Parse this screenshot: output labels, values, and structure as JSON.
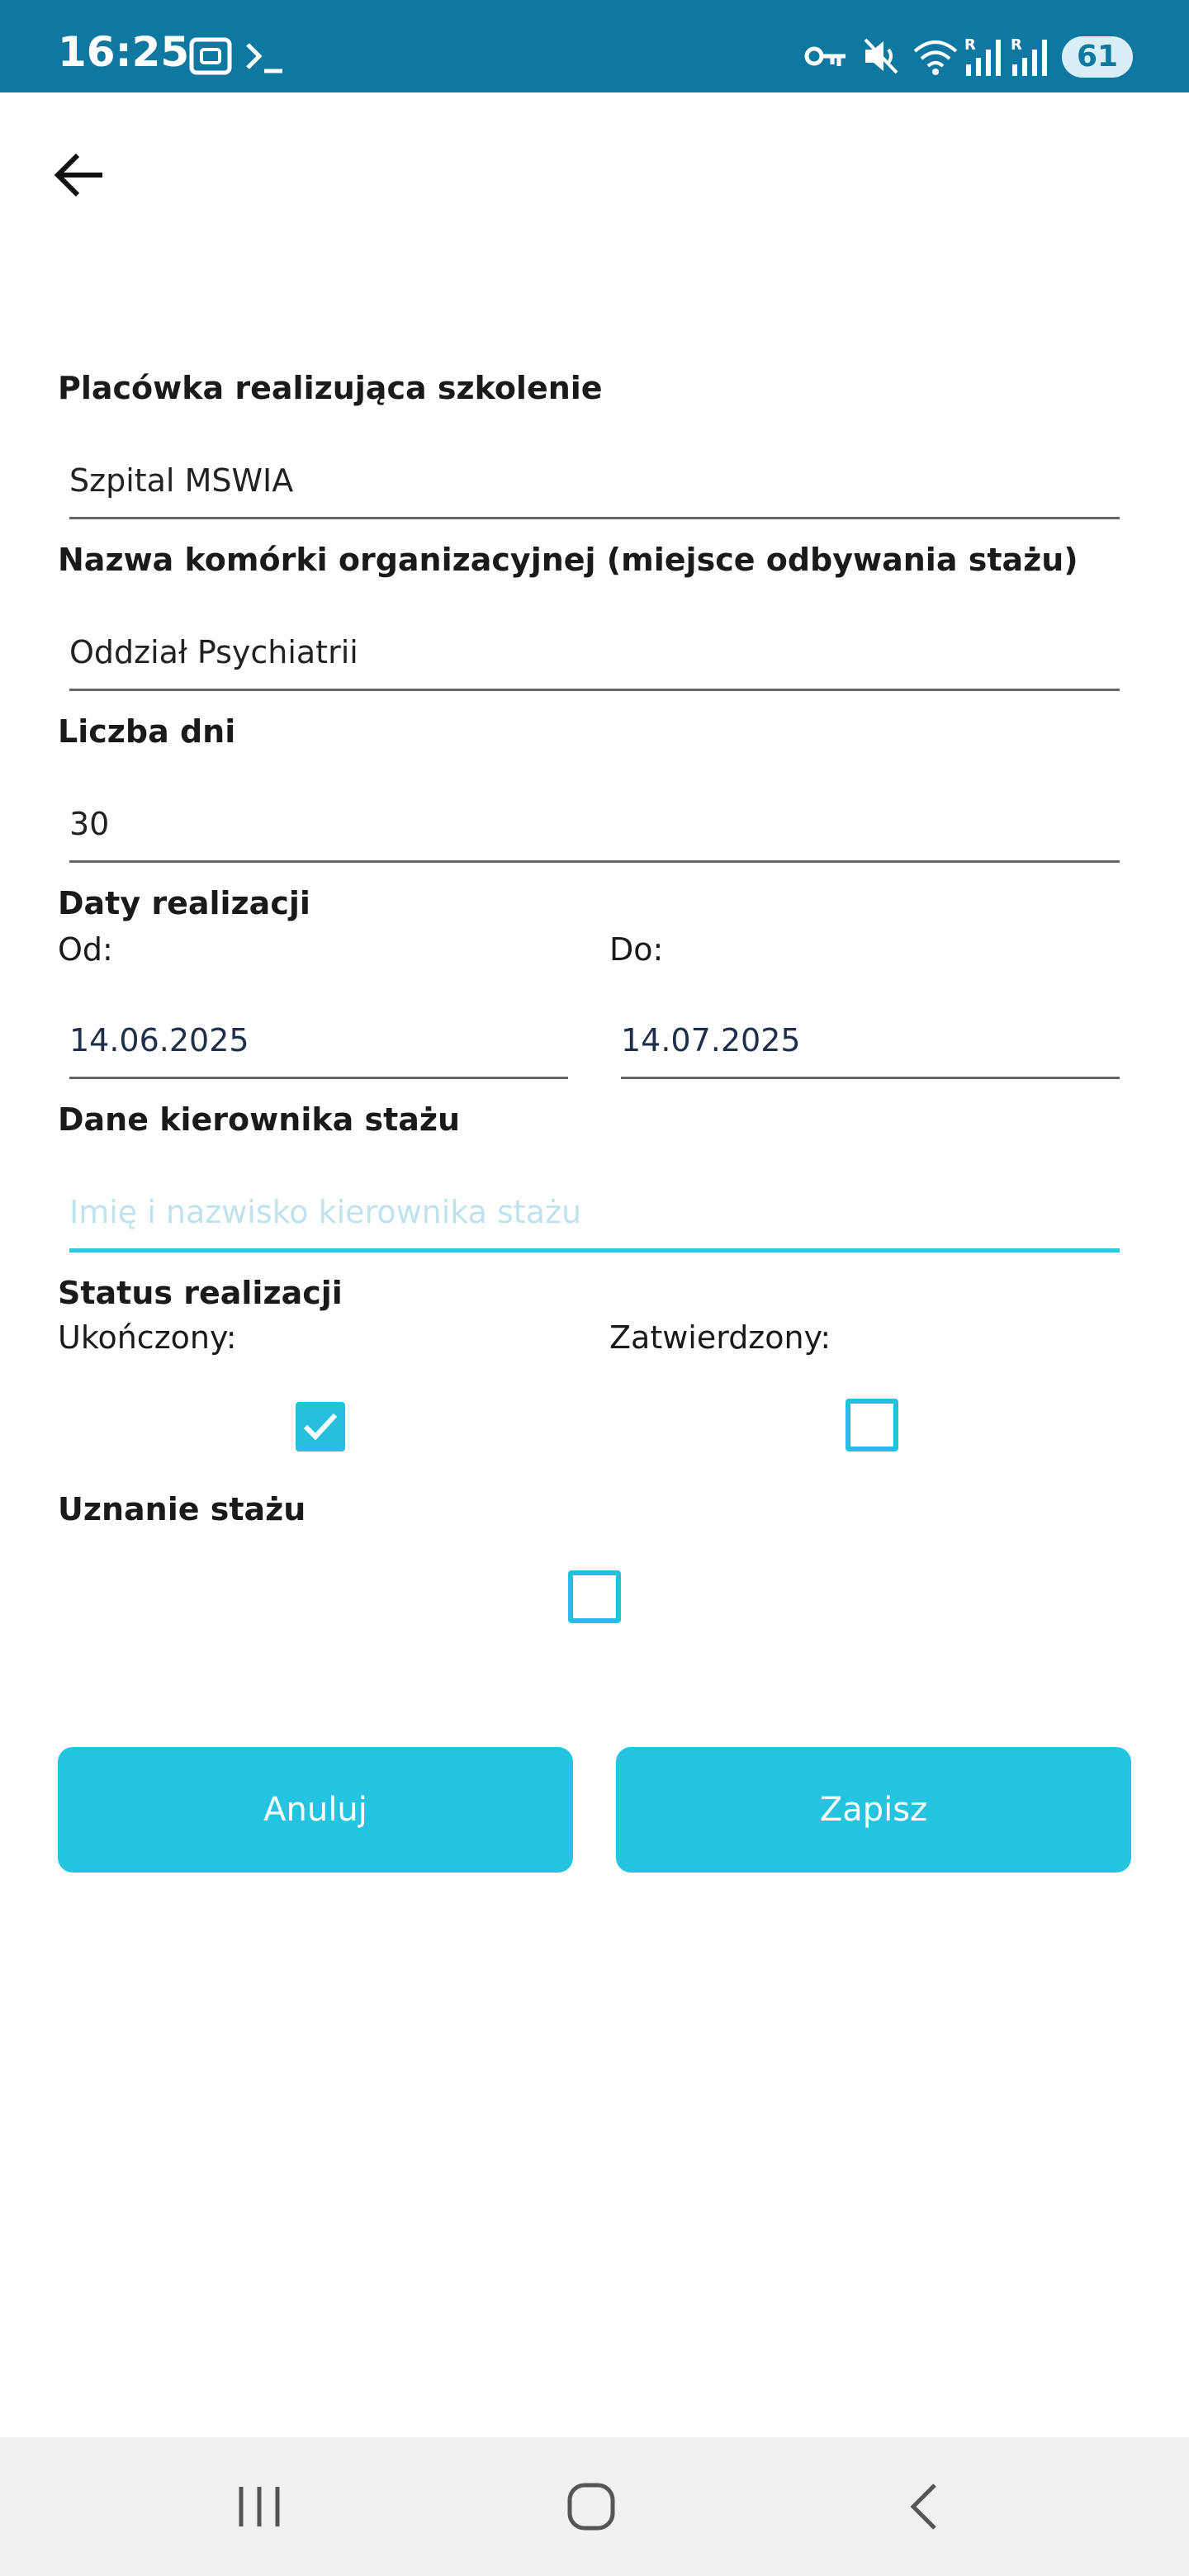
{
  "status_bar": {
    "time": "16:25",
    "battery": "61",
    "icons": [
      "screenshot-icon",
      "terminal-icon",
      "vpn-key-icon",
      "mute-icon",
      "wifi-icon",
      "signal-r-icon",
      "signal-r-icon",
      "battery-icon"
    ]
  },
  "header": {
    "back_icon": "arrow-left-icon"
  },
  "form": {
    "facility": {
      "label": "Placówka realizująca szkolenie",
      "value": "Szpital MSWIA"
    },
    "unit": {
      "label": "Nazwa komórki organizacyjnej (miejsce odbywania stażu)",
      "value": "Oddział Psychiatrii"
    },
    "days": {
      "label": "Liczba dni",
      "value": "30"
    },
    "dates": {
      "label": "Daty realizacji",
      "from_label": "Od:",
      "from_value": "14.06.2025",
      "to_label": "Do:",
      "to_value": "14.07.2025"
    },
    "supervisor": {
      "label": "Dane kierownika stażu",
      "placeholder": "Imię i nazwisko kierownika stażu",
      "value": ""
    },
    "status": {
      "label": "Status realizacji",
      "completed_label": "Ukończony:",
      "completed_checked": true,
      "approved_label": "Zatwierdzony:",
      "approved_checked": false
    },
    "recognition": {
      "label": "Uznanie stażu",
      "checked": false
    }
  },
  "actions": {
    "cancel_label": "Anuluj",
    "save_label": "Zapisz"
  },
  "colors": {
    "status_bar": "#0f78a0",
    "accent": "#24c3df",
    "nav_bar": "#f1f1f3"
  },
  "nav_bar": {
    "icons": [
      "recent-apps-icon",
      "home-icon",
      "back-nav-icon"
    ]
  }
}
